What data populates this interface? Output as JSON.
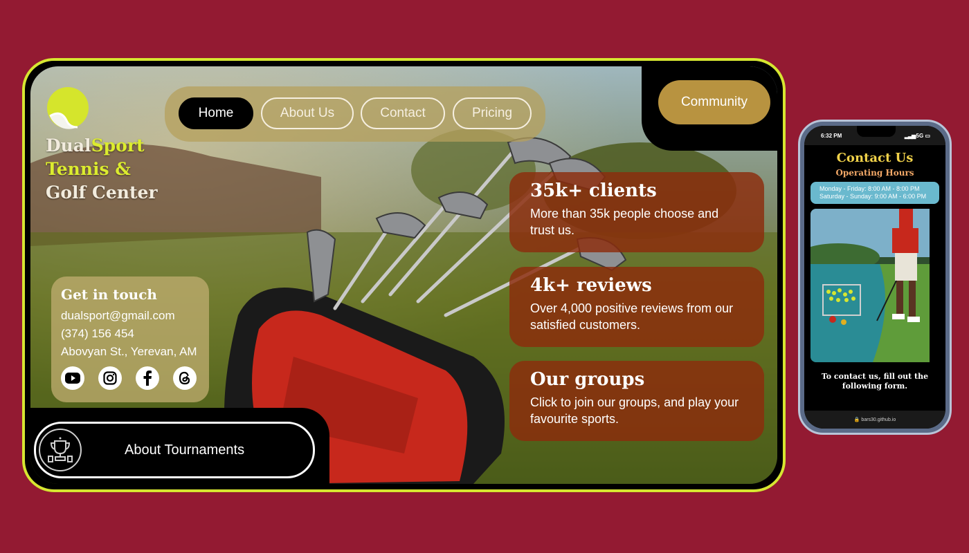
{
  "desktop": {
    "brand": {
      "part1": "Dual",
      "part2": "Sport",
      "line2": "Tennis &",
      "line3": "Golf Center"
    },
    "nav": [
      {
        "label": "Home",
        "active": true
      },
      {
        "label": "About Us",
        "active": false
      },
      {
        "label": "Contact",
        "active": false
      },
      {
        "label": "Pricing",
        "active": false
      }
    ],
    "community_label": "Community",
    "contact": {
      "title": "Get in touch",
      "email": "dualsport@gmail.com",
      "phone": "(374) 156 454",
      "address": "Abovyan St., Yerevan, AM",
      "socials": [
        "youtube-icon",
        "instagram-icon",
        "facebook-icon",
        "threads-icon"
      ]
    },
    "stats": [
      {
        "title": "35k+ clients",
        "desc": "More than 35k people choose and trust us."
      },
      {
        "title": "4k+ reviews",
        "desc": "Over 4,000 positive reviews from our satisfied customers."
      },
      {
        "title": "Our groups",
        "desc": "Click to join our groups, and play your favourite sports."
      }
    ],
    "tournaments_label": "About Tournaments"
  },
  "phone": {
    "time": "6:32 PM",
    "signal": "5G",
    "title": "Contact Us",
    "subtitle": "Operating Hours",
    "hours": [
      "Monday - Friday: 8:00 AM - 8:00 PM",
      "Saturday - Sunday: 9:00 AM - 6:00 PM"
    ],
    "cta": "To contact us, fill out the following form.",
    "url": "bars30.github.io"
  },
  "colors": {
    "page_bg": "#931a32",
    "frame_border": "#d6e631",
    "accent_yellow": "#dcec2f",
    "community_gold": "#b89340",
    "stat_card": "#8c2c0c"
  }
}
